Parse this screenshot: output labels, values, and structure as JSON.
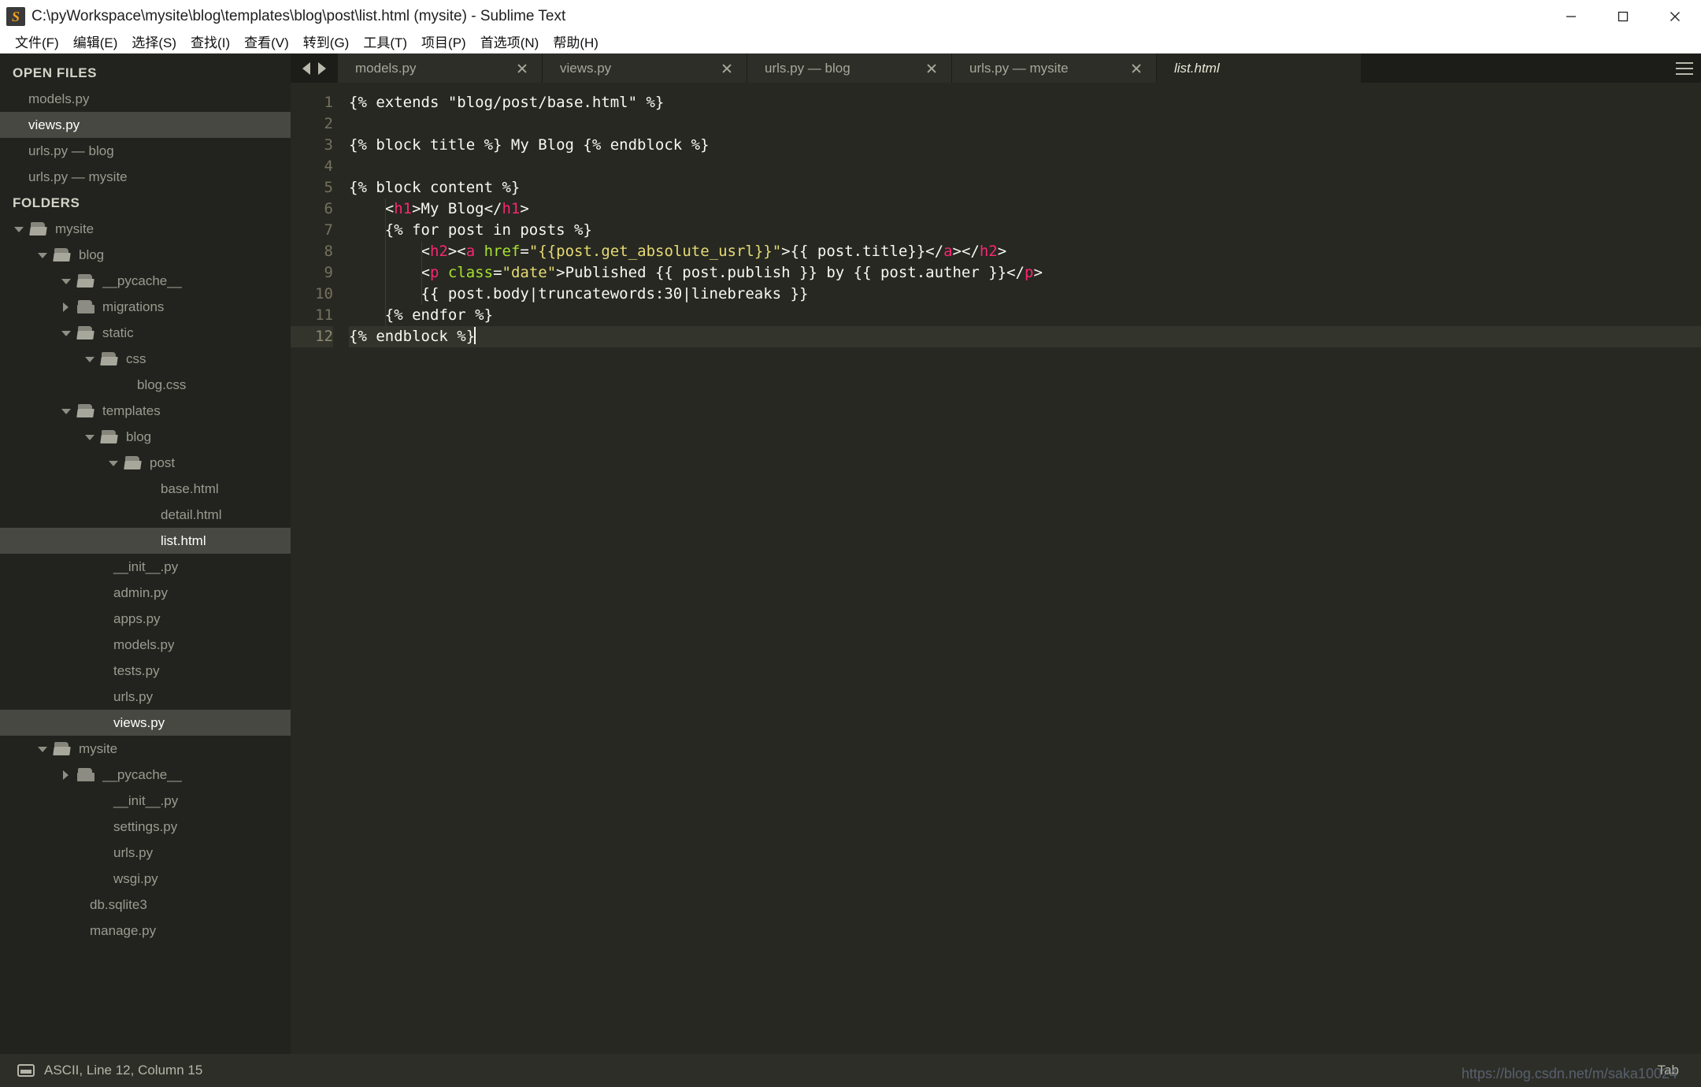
{
  "window": {
    "title": "C:\\pyWorkspace\\mysite\\blog\\templates\\blog\\post\\list.html (mysite) - Sublime Text",
    "app_icon": "sublime-text-icon",
    "minimize_label": "—",
    "maximize_label": "❐",
    "close_label": "✕"
  },
  "menubar": {
    "items": [
      {
        "label": "文件(F)"
      },
      {
        "label": "编辑(E)"
      },
      {
        "label": "选择(S)"
      },
      {
        "label": "查找(I)"
      },
      {
        "label": "查看(V)"
      },
      {
        "label": "转到(G)"
      },
      {
        "label": "工具(T)"
      },
      {
        "label": "项目(P)"
      },
      {
        "label": "首选项(N)"
      },
      {
        "label": "帮助(H)"
      }
    ]
  },
  "sidebar": {
    "open_files_header": "OPEN FILES",
    "open_files": [
      {
        "label": "models.py",
        "selected": false
      },
      {
        "label": "views.py",
        "selected": true
      },
      {
        "label": "urls.py — blog",
        "selected": false
      },
      {
        "label": "urls.py — mysite",
        "selected": false
      }
    ],
    "folders_header": "FOLDERS",
    "tree": [
      {
        "label": "mysite",
        "depth": 0,
        "kind": "folder",
        "state": "open",
        "selected": false
      },
      {
        "label": "blog",
        "depth": 1,
        "kind": "folder",
        "state": "open",
        "selected": false
      },
      {
        "label": "__pycache__",
        "depth": 2,
        "kind": "folder",
        "state": "open",
        "selected": false
      },
      {
        "label": "migrations",
        "depth": 2,
        "kind": "folder",
        "state": "closed",
        "selected": false
      },
      {
        "label": "static",
        "depth": 2,
        "kind": "folder",
        "state": "open",
        "selected": false
      },
      {
        "label": "css",
        "depth": 3,
        "kind": "folder",
        "state": "open",
        "selected": false
      },
      {
        "label": "blog.css",
        "depth": 4,
        "kind": "file",
        "state": "",
        "selected": false
      },
      {
        "label": "templates",
        "depth": 2,
        "kind": "folder",
        "state": "open",
        "selected": false
      },
      {
        "label": "blog",
        "depth": 3,
        "kind": "folder",
        "state": "open",
        "selected": false
      },
      {
        "label": "post",
        "depth": 4,
        "kind": "folder",
        "state": "open",
        "selected": false
      },
      {
        "label": "base.html",
        "depth": 5,
        "kind": "file",
        "state": "",
        "selected": false
      },
      {
        "label": "detail.html",
        "depth": 5,
        "kind": "file",
        "state": "",
        "selected": false
      },
      {
        "label": "list.html",
        "depth": 5,
        "kind": "file",
        "state": "",
        "selected": true
      },
      {
        "label": "__init__.py",
        "depth": 3,
        "kind": "file",
        "state": "",
        "selected": false
      },
      {
        "label": "admin.py",
        "depth": 3,
        "kind": "file",
        "state": "",
        "selected": false
      },
      {
        "label": "apps.py",
        "depth": 3,
        "kind": "file",
        "state": "",
        "selected": false
      },
      {
        "label": "models.py",
        "depth": 3,
        "kind": "file",
        "state": "",
        "selected": false
      },
      {
        "label": "tests.py",
        "depth": 3,
        "kind": "file",
        "state": "",
        "selected": false
      },
      {
        "label": "urls.py",
        "depth": 3,
        "kind": "file",
        "state": "",
        "selected": false
      },
      {
        "label": "views.py",
        "depth": 3,
        "kind": "file",
        "state": "",
        "selected": true
      },
      {
        "label": "mysite",
        "depth": 1,
        "kind": "folder",
        "state": "open",
        "selected": false
      },
      {
        "label": "__pycache__",
        "depth": 2,
        "kind": "folder",
        "state": "closed",
        "selected": false
      },
      {
        "label": "__init__.py",
        "depth": 3,
        "kind": "file",
        "state": "",
        "selected": false
      },
      {
        "label": "settings.py",
        "depth": 3,
        "kind": "file",
        "state": "",
        "selected": false
      },
      {
        "label": "urls.py",
        "depth": 3,
        "kind": "file",
        "state": "",
        "selected": false
      },
      {
        "label": "wsgi.py",
        "depth": 3,
        "kind": "file",
        "state": "",
        "selected": false
      },
      {
        "label": "db.sqlite3",
        "depth": 2,
        "kind": "file",
        "state": "",
        "selected": false
      },
      {
        "label": "manage.py",
        "depth": 2,
        "kind": "file",
        "state": "",
        "selected": false
      }
    ]
  },
  "tabs": {
    "prev_icon": "chevron-left-icon",
    "next_icon": "chevron-right-icon",
    "menu_icon": "hamburger-menu-icon",
    "items": [
      {
        "label": "models.py",
        "active": false
      },
      {
        "label": "views.py",
        "active": false
      },
      {
        "label": "urls.py — blog",
        "active": false
      },
      {
        "label": "urls.py — mysite",
        "active": false
      },
      {
        "label": "list.html",
        "active": true
      }
    ]
  },
  "editor": {
    "lines": [
      {
        "n": "1",
        "current": false,
        "indent": 0,
        "spans": [
          {
            "t": "{% extends \"blog/post/base.html\" %}",
            "c": "plain"
          }
        ]
      },
      {
        "n": "2",
        "current": false,
        "indent": 0,
        "spans": [
          {
            "t": "",
            "c": "plain"
          }
        ]
      },
      {
        "n": "3",
        "current": false,
        "indent": 0,
        "spans": [
          {
            "t": "{% block title %} My Blog {% endblock %}",
            "c": "plain"
          }
        ]
      },
      {
        "n": "4",
        "current": false,
        "indent": 0,
        "spans": [
          {
            "t": "",
            "c": "plain"
          }
        ]
      },
      {
        "n": "5",
        "current": false,
        "indent": 0,
        "spans": [
          {
            "t": "{% block content %}",
            "c": "plain"
          }
        ]
      },
      {
        "n": "6",
        "current": false,
        "indent": 1,
        "spans": [
          {
            "t": "    <",
            "c": "plain"
          },
          {
            "t": "h1",
            "c": "tag"
          },
          {
            "t": ">My Blog</",
            "c": "plain"
          },
          {
            "t": "h1",
            "c": "tag"
          },
          {
            "t": ">",
            "c": "plain"
          }
        ]
      },
      {
        "n": "7",
        "current": false,
        "indent": 1,
        "spans": [
          {
            "t": "    {% for post in posts %}",
            "c": "plain"
          }
        ]
      },
      {
        "n": "8",
        "current": false,
        "indent": 2,
        "spans": [
          {
            "t": "        <",
            "c": "plain"
          },
          {
            "t": "h2",
            "c": "tag"
          },
          {
            "t": "><",
            "c": "plain"
          },
          {
            "t": "a",
            "c": "tag"
          },
          {
            "t": " ",
            "c": "plain"
          },
          {
            "t": "href",
            "c": "attr"
          },
          {
            "t": "=",
            "c": "plain"
          },
          {
            "t": "\"{{post.get_absolute_usrl}}\"",
            "c": "str"
          },
          {
            "t": ">{{ post.title}}</",
            "c": "plain"
          },
          {
            "t": "a",
            "c": "tag"
          },
          {
            "t": "></",
            "c": "plain"
          },
          {
            "t": "h2",
            "c": "tag"
          },
          {
            "t": ">",
            "c": "plain"
          }
        ]
      },
      {
        "n": "9",
        "current": false,
        "indent": 2,
        "spans": [
          {
            "t": "        <",
            "c": "plain"
          },
          {
            "t": "p",
            "c": "tag"
          },
          {
            "t": " ",
            "c": "plain"
          },
          {
            "t": "class",
            "c": "attr"
          },
          {
            "t": "=",
            "c": "plain"
          },
          {
            "t": "\"date\"",
            "c": "str"
          },
          {
            "t": ">Published {{ post.publish }} by {{ post.auther }}</",
            "c": "plain"
          },
          {
            "t": "p",
            "c": "tag"
          },
          {
            "t": ">",
            "c": "plain"
          }
        ]
      },
      {
        "n": "10",
        "current": false,
        "indent": 2,
        "spans": [
          {
            "t": "        {{ post.body|truncatewords:30|linebreaks }}",
            "c": "plain"
          }
        ]
      },
      {
        "n": "11",
        "current": false,
        "indent": 1,
        "spans": [
          {
            "t": "    {% endfor %}",
            "c": "plain"
          }
        ]
      },
      {
        "n": "12",
        "current": true,
        "indent": 0,
        "caret": true,
        "spans": [
          {
            "t": "{% endblock %}",
            "c": "plain"
          }
        ]
      }
    ]
  },
  "statusbar": {
    "encoding_icon": "keyboard-icon",
    "left_text": "ASCII, Line 12, Column 15",
    "tab_label": "Tab"
  },
  "watermark": "https://blog.csdn.net/m/saka10024",
  "colors": {
    "editor_bg": "#272822",
    "sidebar_bg": "#22231e",
    "tab_inactive_bg": "#2d2e28",
    "tag": "#f92672",
    "attr": "#a6e22e",
    "string": "#e6db74",
    "plain": "#f8f8f2",
    "line_number": "#75715e",
    "titlebar_bg": "#ffffff"
  }
}
